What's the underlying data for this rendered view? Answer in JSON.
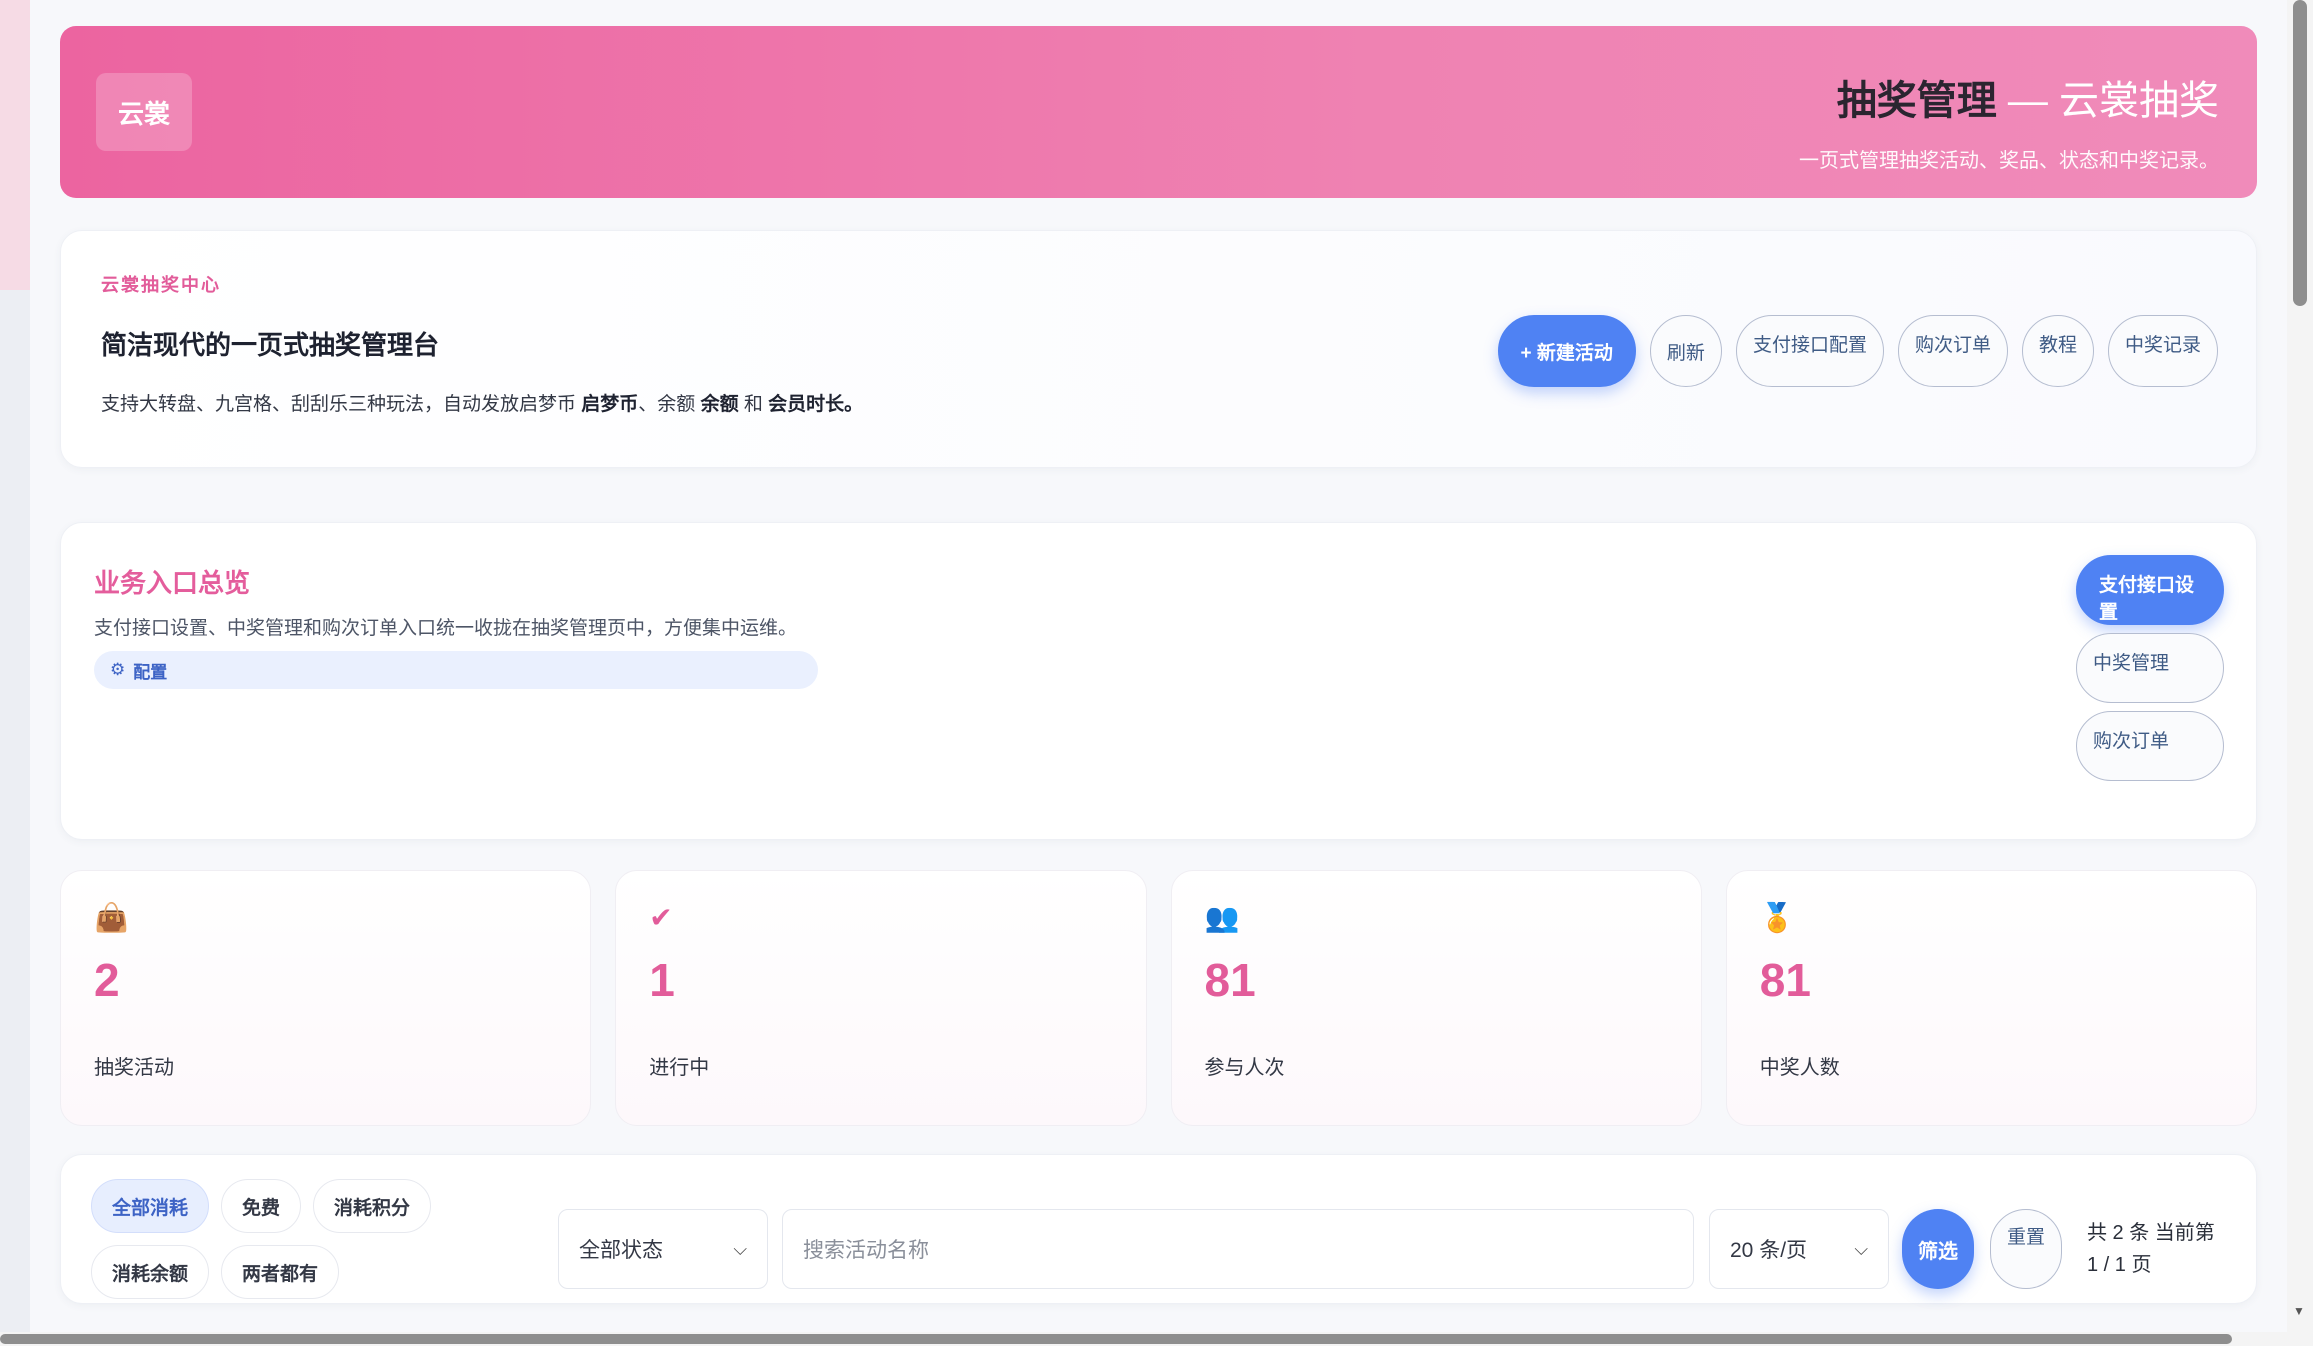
{
  "header": {
    "logo_text": "云裳",
    "title_bold": "抽奖管理",
    "title_rest": " — 云裳抽奖",
    "subtitle": "一页式管理抽奖活动、奖品、状态和中奖记录。"
  },
  "intro": {
    "eyebrow": "云裳抽奖中心",
    "headline": "简洁现代的一页式抽奖管理台",
    "desc_prefix": "支持大转盘、九宫格、刮刮乐三种玩法，自动发放启梦币 ",
    "desc_b1": "启梦币",
    "desc_mid1": "、余额 ",
    "desc_b2": "余额",
    "desc_mid2": " 和 ",
    "desc_b3": "会员时长。",
    "actions": {
      "new": "+ 新建活动",
      "refresh": "刷新",
      "payment_config": "支付接口配置",
      "orders": "购次订单",
      "tutorial": "教程",
      "records": "中奖记录"
    }
  },
  "overview": {
    "title": "业务入口总览",
    "desc": "支付接口设置、中奖管理和购次订单入口统一收拢在抽奖管理页中，方便集中运维。",
    "tag": "配置",
    "side": {
      "payment_settings": "支付接口设置",
      "prize_management": "中奖管理",
      "orders": "购次订单"
    }
  },
  "stats": [
    {
      "icon": "shopping-bag-icon",
      "value": "2",
      "label": "抽奖活动"
    },
    {
      "icon": "check-icon",
      "value": "1",
      "label": "进行中"
    },
    {
      "icon": "people-icon",
      "value": "81",
      "label": "参与人次"
    },
    {
      "icon": "award-icon",
      "value": "81",
      "label": "中奖人数"
    }
  ],
  "filters": {
    "chips": [
      "全部消耗",
      "免费",
      "消耗积分",
      "消耗余额",
      "两者都有"
    ],
    "status_select": "全部状态",
    "search_placeholder": "搜索活动名称",
    "page_size": "20 条/页",
    "filter_btn": "筛选",
    "reset_btn": "重置",
    "page_info_1": "共 2 条 当前第",
    "page_info_2": "1 / 1 页"
  },
  "colors": {
    "accent_pink": "#e25c9a",
    "primary_blue": "#4f82f3"
  }
}
